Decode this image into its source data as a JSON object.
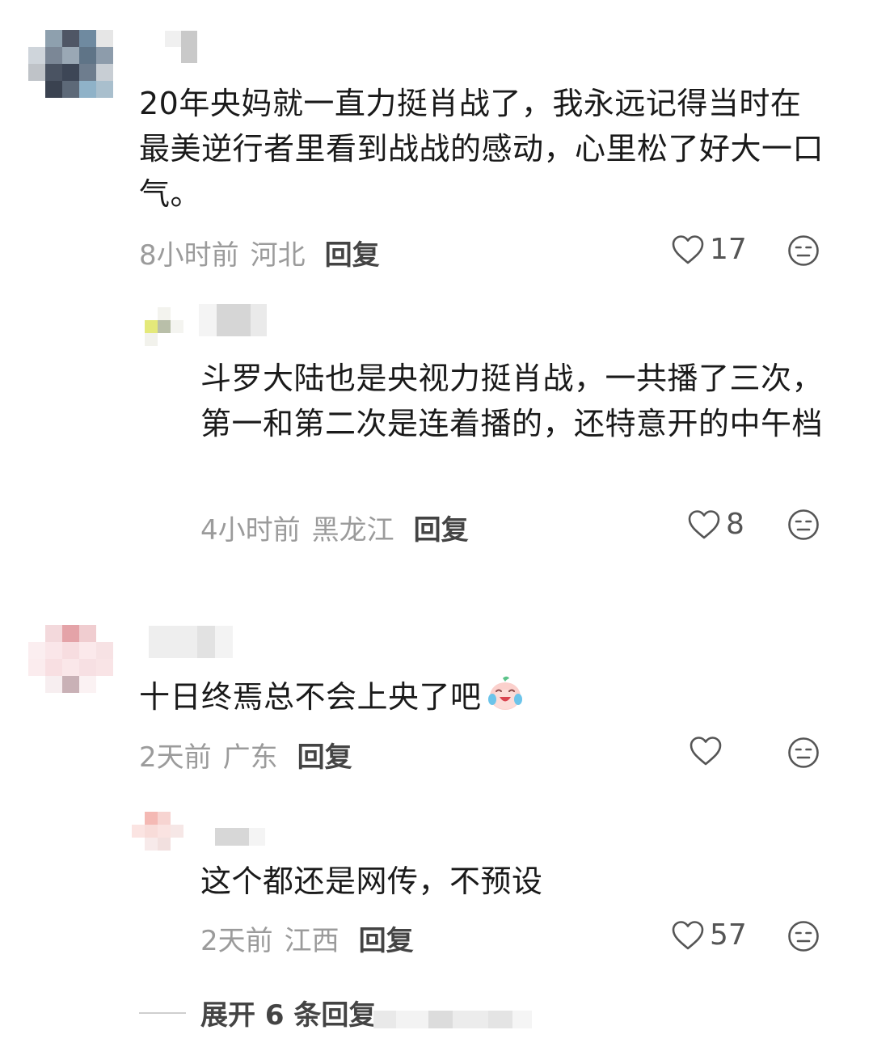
{
  "comments": [
    {
      "text": "20年央妈就一直力挺肖战了，我永远记得当时在最美逆行者里看到战战的感动，心里松了好大一口气。",
      "time": "8小时前",
      "location": "河北",
      "reply_label": "回复",
      "likes": "17",
      "replies": [
        {
          "text": "斗罗大陆也是央视力挺肖战，一共播了三次，第一和第二次是连着播的，还特意开的中午档",
          "time": "4小时前",
          "location": "黑龙江",
          "reply_label": "回复",
          "likes": "8"
        }
      ]
    },
    {
      "text": "十日终焉总不会上央了吧",
      "emoji": "crying-laughing-emoji",
      "time": "2天前",
      "location": "广东",
      "reply_label": "回复",
      "likes": "",
      "replies": [
        {
          "text": "这个都还是网传，不预设",
          "time": "2天前",
          "location": "江西",
          "reply_label": "回复",
          "likes": "57"
        }
      ]
    }
  ],
  "expand_label": "展开 6 条回复",
  "icons": {
    "like": "heart-outline-icon",
    "dislike": "meh-face-icon"
  },
  "colors": {
    "text": "#1a1a1a",
    "meta": "#9b9b9b",
    "reply": "#444444"
  }
}
